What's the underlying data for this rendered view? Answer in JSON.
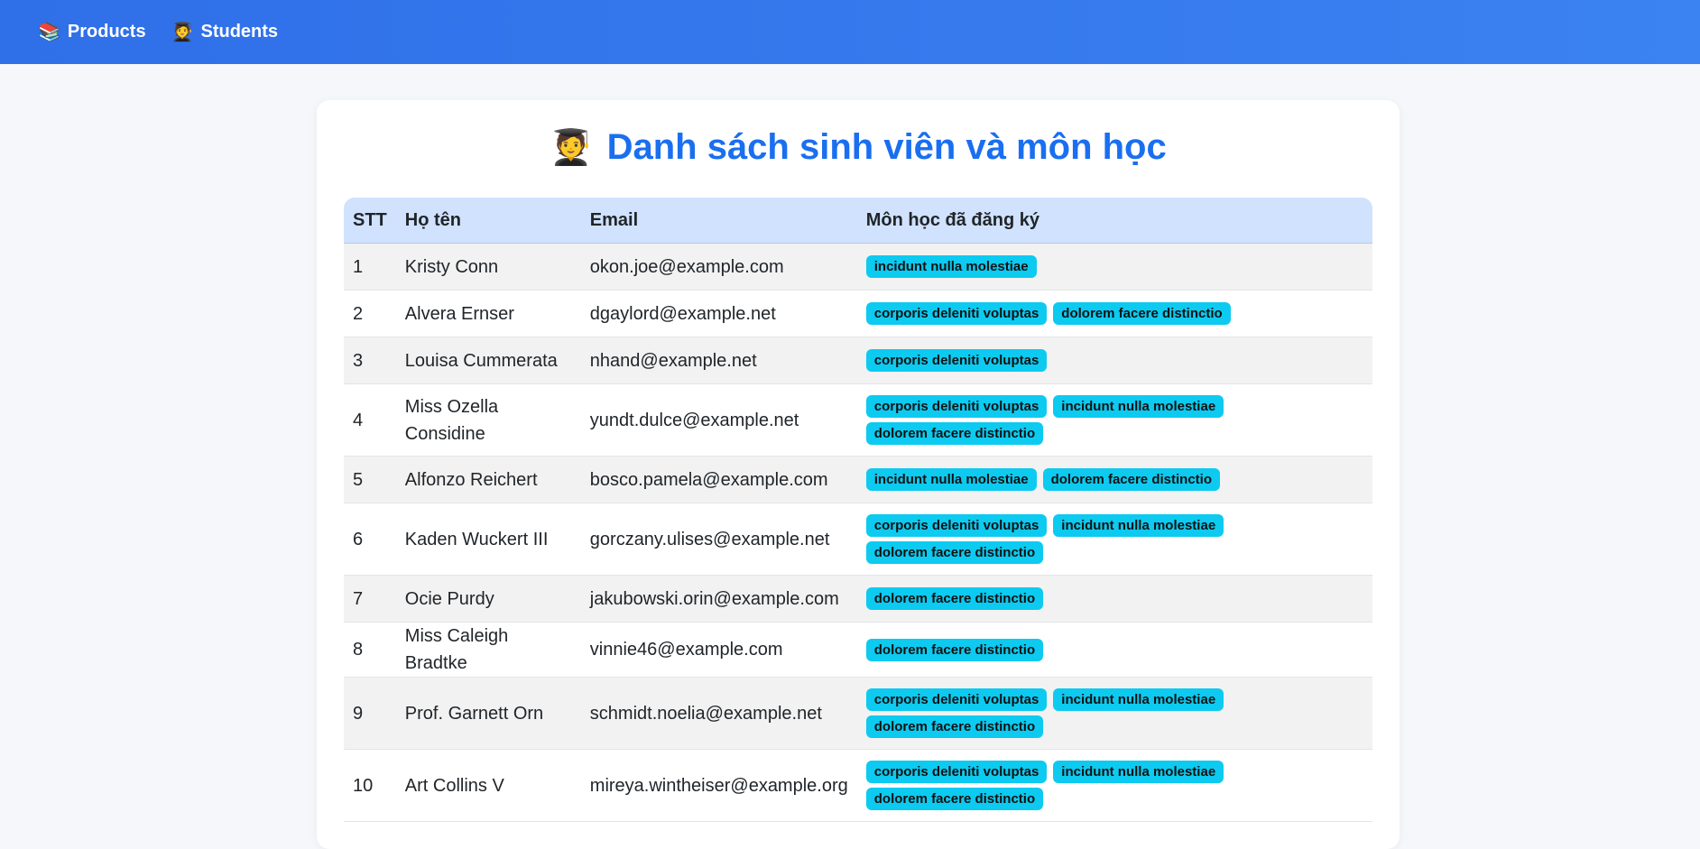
{
  "nav": {
    "items": [
      {
        "icon": "📚",
        "label": "Products"
      },
      {
        "icon": "🧑‍🎓",
        "label": "Students"
      }
    ]
  },
  "page": {
    "title_icon": "🧑‍🎓",
    "title": "Danh sách sinh viên và môn học"
  },
  "table": {
    "headers": [
      "STT",
      "Họ tên",
      "Email",
      "Môn học đã đăng ký"
    ],
    "rows": [
      {
        "stt": "1",
        "name": "Kristy Conn",
        "email": "okon.joe@example.com",
        "courses": [
          "incidunt nulla molestiae"
        ]
      },
      {
        "stt": "2",
        "name": "Alvera Ernser",
        "email": "dgaylord@example.net",
        "courses": [
          "corporis deleniti voluptas",
          "dolorem facere distinctio"
        ]
      },
      {
        "stt": "3",
        "name": "Louisa Cummerata",
        "email": "nhand@example.net",
        "courses": [
          "corporis deleniti voluptas"
        ]
      },
      {
        "stt": "4",
        "name": "Miss Ozella Considine",
        "email": "yundt.dulce@example.net",
        "courses": [
          "corporis deleniti voluptas",
          "incidunt nulla molestiae",
          "dolorem facere distinctio"
        ]
      },
      {
        "stt": "5",
        "name": "Alfonzo Reichert",
        "email": "bosco.pamela@example.com",
        "courses": [
          "incidunt nulla molestiae",
          "dolorem facere distinctio"
        ]
      },
      {
        "stt": "6",
        "name": "Kaden Wuckert III",
        "email": "gorczany.ulises@example.net",
        "courses": [
          "corporis deleniti voluptas",
          "incidunt nulla molestiae",
          "dolorem facere distinctio"
        ]
      },
      {
        "stt": "7",
        "name": "Ocie Purdy",
        "email": "jakubowski.orin@example.com",
        "courses": [
          "dolorem facere distinctio"
        ]
      },
      {
        "stt": "8",
        "name": "Miss Caleigh Bradtke",
        "email": "vinnie46@example.com",
        "courses": [
          "dolorem facere distinctio"
        ]
      },
      {
        "stt": "9",
        "name": "Prof. Garnett Orn",
        "email": "schmidt.noelia@example.net",
        "courses": [
          "corporis deleniti voluptas",
          "incidunt nulla molestiae",
          "dolorem facere distinctio"
        ]
      },
      {
        "stt": "10",
        "name": "Art Collins V",
        "email": "mireya.wintheiser@example.org",
        "courses": [
          "corporis deleniti voluptas",
          "incidunt nulla molestiae",
          "dolorem facere distinctio"
        ]
      }
    ]
  }
}
